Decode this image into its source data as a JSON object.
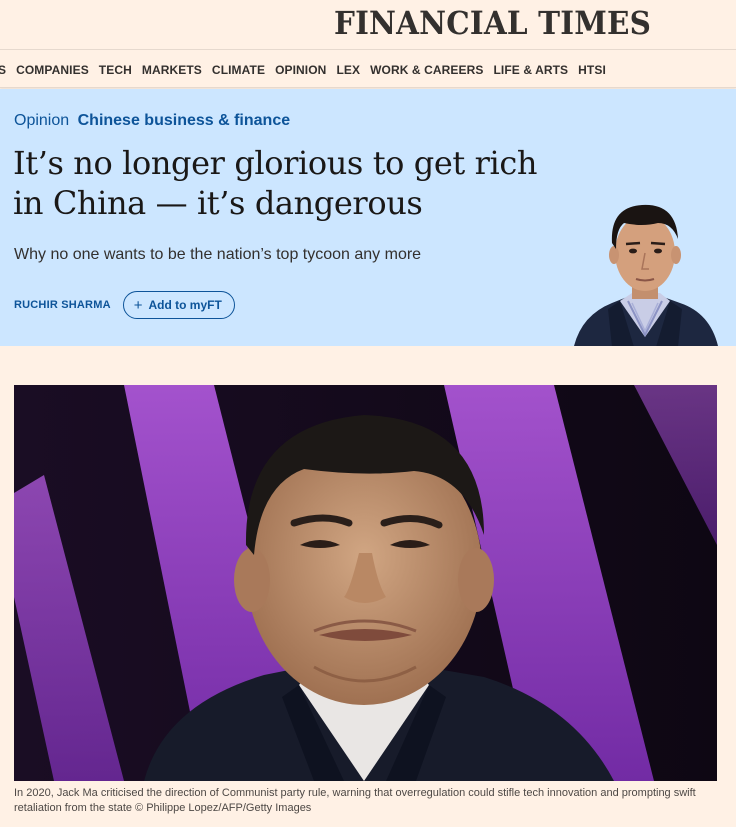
{
  "masthead": {
    "logo": "FINANCIAL TIMES"
  },
  "nav": {
    "items": [
      "S",
      "COMPANIES",
      "TECH",
      "MARKETS",
      "CLIMATE",
      "OPINION",
      "LEX",
      "WORK & CAREERS",
      "LIFE & ARTS",
      "HTSI"
    ]
  },
  "article": {
    "kicker": "Opinion",
    "topic": "Chinese business & finance",
    "headline": "It’s no longer glorious to get rich in China — it’s dangerous",
    "standfirst": "Why no one wants to be the nation’s top tycoon any more",
    "author": "RUCHIR SHARMA",
    "add_myft_label": "Add to myFT",
    "caption": "In 2020, Jack Ma criticised the direction of Communist party rule, warning that overregulation could stifle tech innovation and prompting swift retaliation from the state © Philippe Lopez/AFP/Getty Images"
  },
  "colors": {
    "page_background": "#fff1e5",
    "header_band": "#cce6ff",
    "link_blue": "#0d5499",
    "text": "#33302e"
  }
}
